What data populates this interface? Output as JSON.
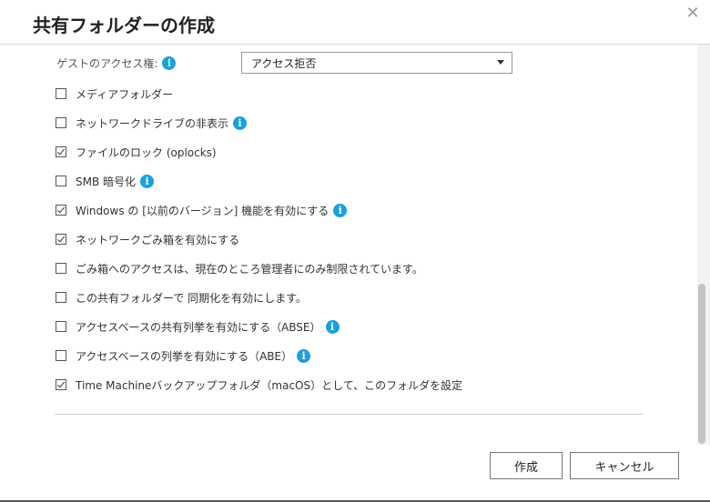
{
  "dialog": {
    "title": "共有フォルダーの作成",
    "close_glyph": "✕"
  },
  "guest_access": {
    "label": "ゲストのアクセス権:",
    "selected": "アクセス拒否"
  },
  "options": [
    {
      "label": "メディアフォルダー",
      "checked": false,
      "info": false
    },
    {
      "label": "ネットワークドライブの非表示",
      "checked": false,
      "info": true
    },
    {
      "label": "ファイルのロック (oplocks)",
      "checked": true,
      "info": false
    },
    {
      "label": "SMB 暗号化",
      "checked": false,
      "info": true
    },
    {
      "label": "Windows の [以前のバージョン] 機能を有効にする",
      "checked": true,
      "info": true
    },
    {
      "label": "ネットワークごみ箱を有効にする",
      "checked": true,
      "info": false
    },
    {
      "label": "ごみ箱へのアクセスは、現在のところ管理者にのみ制限されています。",
      "checked": false,
      "info": false
    },
    {
      "label": "この共有フォルダーで 同期化を有効にします。",
      "checked": false,
      "info": false
    },
    {
      "label": "アクセスベースの共有列挙を有効にする（ABSE）",
      "checked": false,
      "info": true
    },
    {
      "label": "アクセスベースの列挙を有効にする（ABE）",
      "checked": false,
      "info": true
    },
    {
      "label": "Time Machineバックアップフォルダ（macOS）として、このフォルダを設定",
      "checked": true,
      "info": false
    }
  ],
  "footer": {
    "create_label": "作成",
    "cancel_label": "キャンセル"
  },
  "info_glyph": "i",
  "colors": {
    "info_icon": "#1a9fe0",
    "border": "#777777"
  }
}
